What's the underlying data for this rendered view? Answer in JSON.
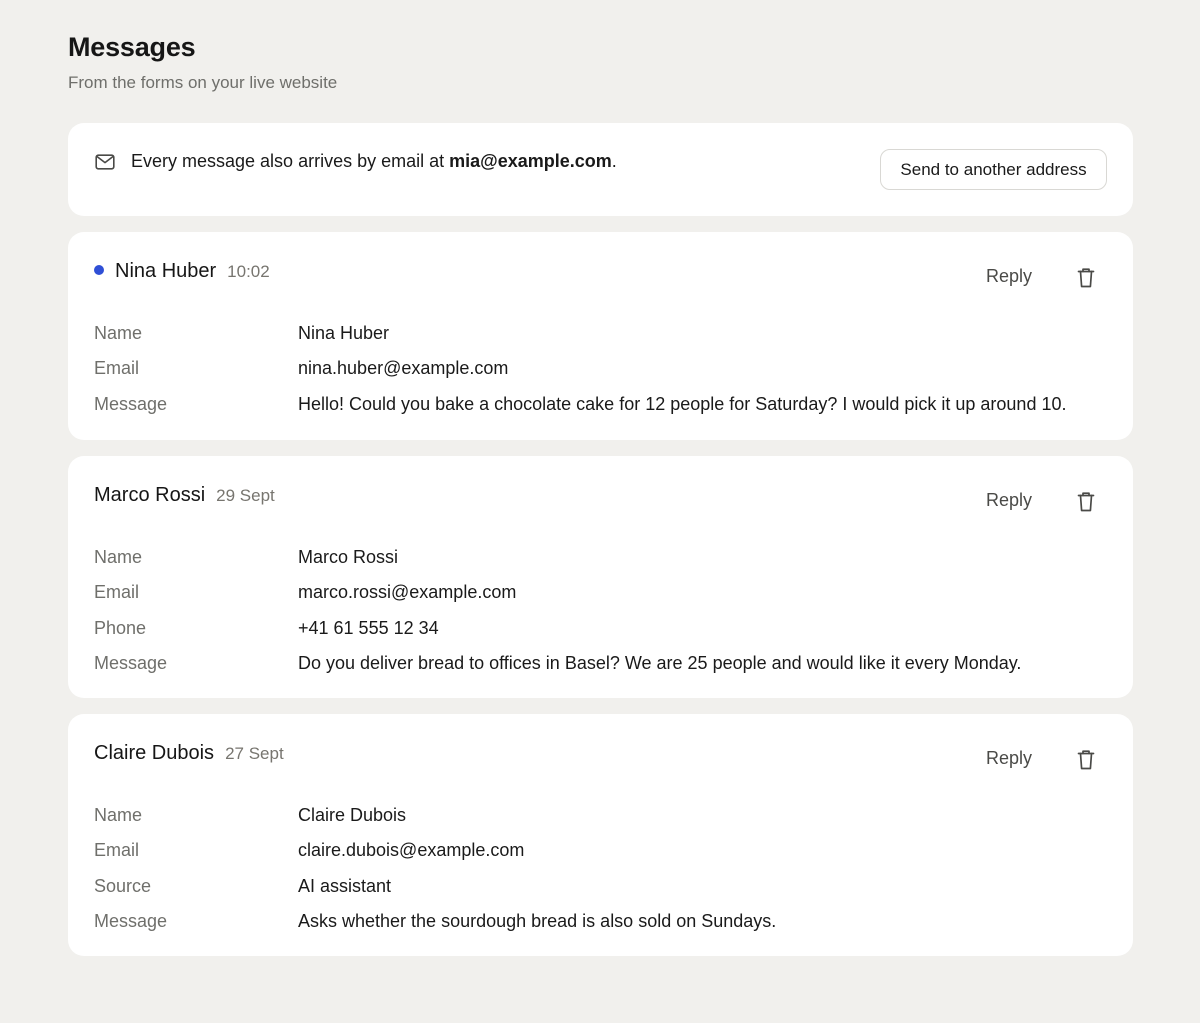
{
  "header": {
    "title": "Messages",
    "subtitle": "From the forms on your live website"
  },
  "notice": {
    "icon": "mail-icon",
    "text": "Every message also arrives by email at ",
    "email": "mia@example.com",
    "suffix": ".",
    "button_label": "Send to another address"
  },
  "colors": {
    "background": "#f1f0ed",
    "card": "#ffffff",
    "unread_dot": "#2f4fd6"
  },
  "messages": [
    {
      "sender": "Nina Huber",
      "time": "10:02",
      "unread": true,
      "reply_label": "Reply",
      "delete_icon": "trash-icon",
      "fields": [
        {
          "label": "Name",
          "value": "Nina Huber"
        },
        {
          "label": "Email",
          "value": "nina.huber@example.com"
        },
        {
          "label": "Message",
          "value": "Hello! Could you bake a chocolate cake for 12 people for Saturday? I would pick it up around 10."
        }
      ]
    },
    {
      "sender": "Marco Rossi",
      "time": "29 Sept",
      "unread": false,
      "reply_label": "Reply",
      "delete_icon": "trash-icon",
      "fields": [
        {
          "label": "Name",
          "value": "Marco Rossi"
        },
        {
          "label": "Email",
          "value": "marco.rossi@example.com"
        },
        {
          "label": "Phone",
          "value": "+41 61 555 12 34"
        },
        {
          "label": "Message",
          "value": "Do you deliver bread to offices in Basel? We are 25 people and would like it every Monday."
        }
      ]
    },
    {
      "sender": "Claire Dubois",
      "time": "27 Sept",
      "unread": false,
      "reply_label": "Reply",
      "delete_icon": "trash-icon",
      "fields": [
        {
          "label": "Name",
          "value": "Claire Dubois"
        },
        {
          "label": "Email",
          "value": "claire.dubois@example.com"
        },
        {
          "label": "Source",
          "value": "AI assistant"
        },
        {
          "label": "Message",
          "value": "Asks whether the sourdough bread is also sold on Sundays."
        }
      ]
    }
  ]
}
